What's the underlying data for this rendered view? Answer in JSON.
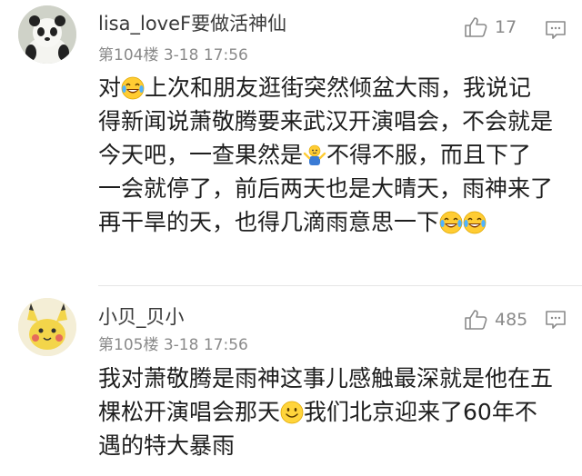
{
  "comments": [
    {
      "username": "lisa_loveF要做活神仙",
      "floor": "第104楼",
      "time": "3-18 17:56",
      "likes": "17",
      "avatar_icon": "panda-avatar",
      "content": [
        {
          "text": "对"
        },
        {
          "emoji": "laughing-tears-emoji"
        },
        {
          "text": "上次和朋友逛街突然倾盆大雨，我说记得新闻说萧敬腾要来武汉开演唱会，不会就是今天吧，一查果然是"
        },
        {
          "emoji": "shrug-emoji"
        },
        {
          "text": "不得不服，而且下了一会就停了，前后两天也是大晴天，雨神来了再干旱的天，也得几滴雨意思一下"
        },
        {
          "emoji": "laughing-tears-emoji"
        },
        {
          "emoji": "laughing-tears-emoji"
        }
      ]
    },
    {
      "username": "小贝_贝小",
      "floor": "第105楼",
      "time": "3-18 17:56",
      "likes": "485",
      "avatar_icon": "pikachu-avatar",
      "content": [
        {
          "text": "我对萧敬腾是雨神这事儿感触最深就是他在五棵松开演唱会那天"
        },
        {
          "emoji": "smile-emoji"
        },
        {
          "text": "我们北京迎来了60年不遇的特大暴雨"
        }
      ]
    }
  ],
  "icons": {
    "like": "thumbs-up-icon",
    "reply": "comment-bubble-icon"
  },
  "colors": {
    "meta_text": "#8a8a8a",
    "username_text": "#3a3a3a",
    "content_text": "#1e1e1e"
  }
}
